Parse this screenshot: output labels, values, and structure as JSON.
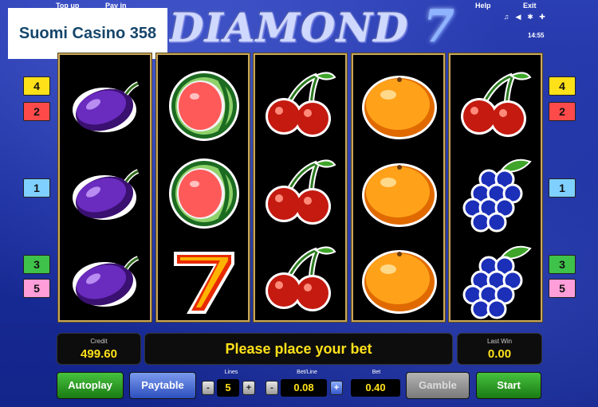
{
  "top_menu": {
    "topup_label": "Top up",
    "payin_label": "Pay in",
    "help_label": "Help",
    "exit_label": "Exit"
  },
  "game_title": {
    "word": "DIAMOND",
    "number": "7"
  },
  "brand": {
    "name": "Suomi Casino 358"
  },
  "system": {
    "icons": [
      "music-icon",
      "sound-icon",
      "settings-icon",
      "fullscreen-icon"
    ],
    "clock": "14:55"
  },
  "reels": [
    [
      "plum",
      "plum",
      "plum"
    ],
    [
      "watermelon",
      "watermelon",
      "seven"
    ],
    [
      "cherry",
      "cherry",
      "cherry"
    ],
    [
      "orange",
      "orange",
      "orange"
    ],
    [
      "cherry",
      "grapes",
      "grapes"
    ]
  ],
  "line_markers_left": [
    {
      "label": "4",
      "color": "#ffe11a"
    },
    {
      "label": "2",
      "color": "#ff4a4a"
    },
    {
      "label": "1",
      "color": "#7fd0ff"
    },
    {
      "label": "3",
      "color": "#3fc24a"
    },
    {
      "label": "5",
      "color": "#ff9ed8"
    }
  ],
  "line_markers_right": [
    {
      "label": "4",
      "color": "#ffe11a"
    },
    {
      "label": "2",
      "color": "#ff4a4a"
    },
    {
      "label": "1",
      "color": "#7fd0ff"
    },
    {
      "label": "3",
      "color": "#3fc24a"
    },
    {
      "label": "5",
      "color": "#ff9ed8"
    }
  ],
  "panel": {
    "credit_label": "Credit",
    "credit_value": "499.60",
    "message": "Please place your bet",
    "lastwin_label": "Last Win",
    "lastwin_value": "0.00"
  },
  "controls": {
    "autoplay_label": "Autoplay",
    "paytable_label": "Paytable",
    "lines_label": "Lines",
    "lines_value": "5",
    "betline_label": "Bet/Line",
    "betline_value": "0.08",
    "bet_label": "Bet",
    "bet_value": "0.40",
    "gamble_label": "Gamble",
    "start_label": "Start",
    "minus_symbol": "-",
    "plus_symbol": "+"
  },
  "colors": {
    "accent_yellow": "#ffe11a",
    "reel_border": "#c9a75a",
    "background_blue": "#1a2d9c"
  }
}
